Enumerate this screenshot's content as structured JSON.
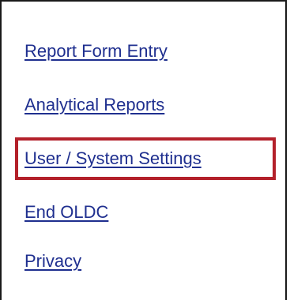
{
  "menu": {
    "items": [
      {
        "label": "Report Form Entry"
      },
      {
        "label": "Analytical Reports"
      },
      {
        "label": "User / System Settings",
        "highlighted": true
      },
      {
        "label": "End OLDC"
      },
      {
        "label": "Privacy"
      }
    ]
  },
  "colors": {
    "link": "#1f2f8f",
    "highlight": "#b3202a",
    "border": "#1a1a1a",
    "background": "#ffffff"
  }
}
